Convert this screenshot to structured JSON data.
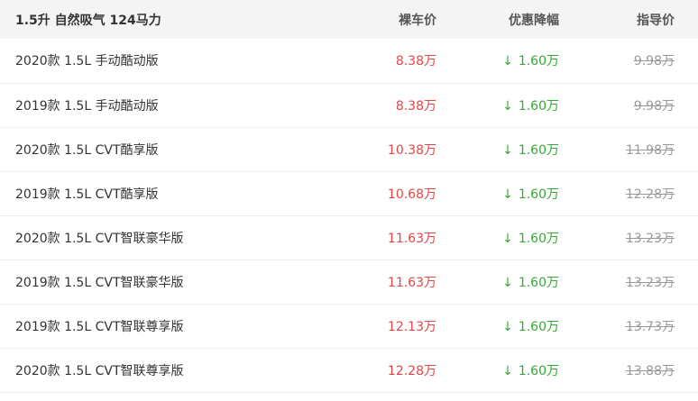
{
  "header": {
    "trim_group": "1.5升 自然吸气 124马力",
    "bare_price": "裸车价",
    "discount": "优惠降幅",
    "guide_price": "指导价"
  },
  "rows": [
    {
      "name": "2020款 1.5L 手动酷动版",
      "bare_price": "8.38万",
      "discount": "1.60万",
      "guide_price": "9.98万"
    },
    {
      "name": "2019款 1.5L 手动酷动版",
      "bare_price": "8.38万",
      "discount": "1.60万",
      "guide_price": "9.98万"
    },
    {
      "name": "2020款 1.5L CVT酷享版",
      "bare_price": "10.38万",
      "discount": "1.60万",
      "guide_price": "11.98万"
    },
    {
      "name": "2019款 1.5L CVT酷享版",
      "bare_price": "10.68万",
      "discount": "1.60万",
      "guide_price": "12.28万"
    },
    {
      "name": "2020款 1.5L CVT智联豪华版",
      "bare_price": "11.63万",
      "discount": "1.60万",
      "guide_price": "13.23万"
    },
    {
      "name": "2019款 1.5L CVT智联豪华版",
      "bare_price": "11.63万",
      "discount": "1.60万",
      "guide_price": "13.23万"
    },
    {
      "name": "2019款 1.5L CVT智联尊享版",
      "bare_price": "12.13万",
      "discount": "1.60万",
      "guide_price": "13.73万"
    },
    {
      "name": "2020款 1.5L CVT智联尊享版",
      "bare_price": "12.28万",
      "discount": "1.60万",
      "guide_price": "13.88万"
    }
  ],
  "icons": {
    "down_arrow": "↓"
  },
  "colors": {
    "bare_price": "#e64545",
    "discount": "#33aa33",
    "guide_price": "#999999",
    "header_bg": "#f4f4f4"
  }
}
